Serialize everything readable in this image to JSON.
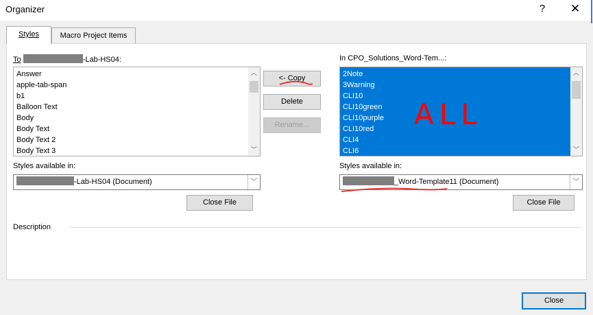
{
  "window": {
    "title": "Organizer",
    "help_glyph": "?",
    "close_glyph": "✕"
  },
  "tabs": [
    {
      "label": "Styles",
      "active": true
    },
    {
      "label": "Macro Project Items",
      "active": false
    }
  ],
  "left": {
    "label_prefix": "To",
    "label_suffix": "-Lab-HS04:",
    "items": [
      "Answer",
      "apple-tab-span",
      "b1",
      "Balloon Text",
      "Body",
      "Body Text",
      "Body Text 2",
      "Body Text 3"
    ],
    "available_label": "Styles available in:",
    "available_value": "-Lab-HS04 (Document)",
    "close_file": "Close File"
  },
  "right": {
    "label": "In CPO_Solutions_Word-Tem...:",
    "items": [
      "2Note",
      "3Warning",
      "CLI10",
      "CLI10green",
      "CLI10purple",
      "CLI10red",
      "CLI4",
      "CLI6"
    ],
    "available_label": "Styles available in:",
    "available_value": "_Word-Template11 (Document)",
    "close_file": "Close File"
  },
  "actions": {
    "copy": "<- Copy",
    "delete": "Delete",
    "rename": "Rename..."
  },
  "description_label": "Description",
  "close_button": "Close",
  "annotation": {
    "text": "ALL",
    "color": "#ff0000"
  }
}
